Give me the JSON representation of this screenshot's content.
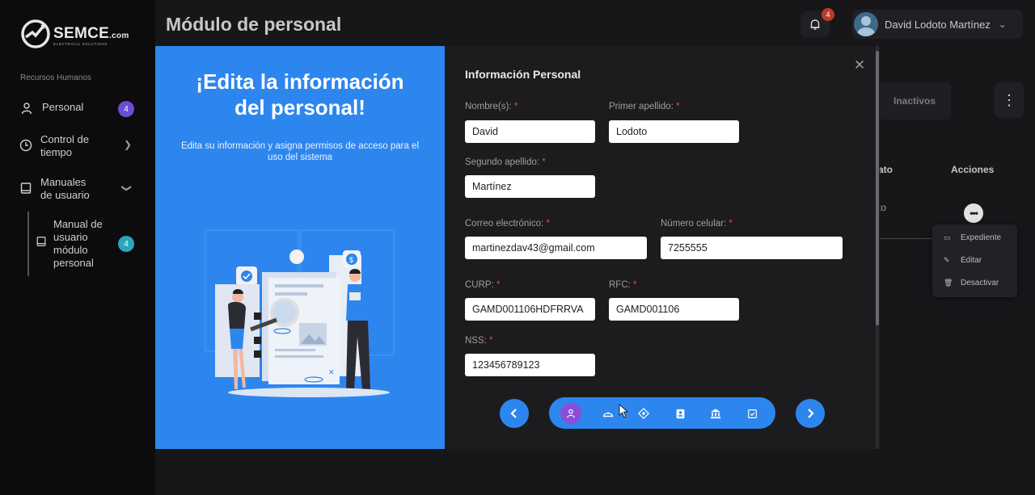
{
  "sidebar": {
    "logo_main": "SEMCE",
    "logo_suffix": ".com",
    "logo_sub": "ELECTRICAL SOLUTIONS",
    "section_label": "Recursos Humanos",
    "items": [
      {
        "label": "Personal",
        "badge": "4",
        "icon": "user-icon"
      },
      {
        "label": "Control de tiempo",
        "icon": "clock-icon"
      },
      {
        "label": "Manuales de usuario",
        "icon": "book-icon"
      },
      {
        "label": "Manual de usuario módulo personal",
        "badge": "4",
        "icon": "book-icon"
      }
    ]
  },
  "header": {
    "title": "Módulo de personal",
    "notification_count": "4",
    "user_name": "David Lodoto Martínez"
  },
  "background": {
    "tab_inactive": "Inactivos",
    "col_status_partial": "ato",
    "col_actions": "Acciones",
    "row_status_partial": "to",
    "context_menu": [
      {
        "label": "Expediente",
        "icon": "folder-icon"
      },
      {
        "label": "Editar",
        "icon": "pencil-icon"
      },
      {
        "label": "Desactivar",
        "icon": "trash-icon"
      }
    ]
  },
  "modal": {
    "heading_line1": "¡Edita la información",
    "heading_line2": "del personal!",
    "subtitle": "Edita su información y asigna permisos de acceso para el uso del sistema",
    "form_title": "Información Personal",
    "fields": {
      "nombre": {
        "label": "Nombre(s):",
        "value": "David"
      },
      "primer_apellido": {
        "label": "Primer apellido:",
        "value": "Lodoto"
      },
      "segundo_apellido": {
        "label": "Segundo apellido:",
        "value": "Martínez"
      },
      "correo": {
        "label": "Correo electrónico:",
        "value": "martinezdav43@gmail.com"
      },
      "celular": {
        "label": "Número celular:",
        "value": "7255555"
      },
      "curp": {
        "label": "CURP:",
        "value": "GAMD001106HDFRRVA"
      },
      "rfc": {
        "label": "RFC:",
        "value": "GAMD001106"
      },
      "nss": {
        "label": "NSS:",
        "value": "123456789123"
      }
    },
    "required_mark": "*",
    "steps": [
      {
        "icon": "user-icon",
        "active": true
      },
      {
        "icon": "helmet-icon",
        "active": false
      },
      {
        "icon": "location-icon",
        "active": false
      },
      {
        "icon": "contact-card-icon",
        "active": false
      },
      {
        "icon": "bank-icon",
        "active": false
      },
      {
        "icon": "checklist-icon",
        "active": false
      }
    ]
  },
  "colors": {
    "accent_blue": "#2d86ee",
    "active_step": "#8a4fd9",
    "badge_purple": "#6c4cd6",
    "badge_teal": "#2aa6b8",
    "notif_red": "#c0392b"
  }
}
